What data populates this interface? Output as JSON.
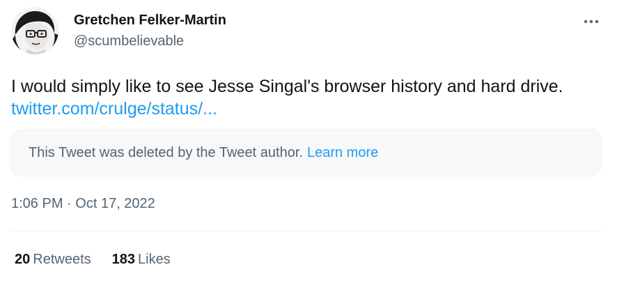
{
  "author": {
    "display_name": "Gretchen Felker-Martin",
    "handle": "@scumbelievable",
    "avatar_icon": "profile-portrait-drawing"
  },
  "tweet": {
    "text": "I would simply like to see Jesse Singal's browser history and hard drive.",
    "link_text": "twitter.com/crulge/status/..."
  },
  "quoted_tweet": {
    "message": "This Tweet was deleted by the Tweet author.",
    "learn_more_label": "Learn more"
  },
  "meta": {
    "time": "1:06 PM",
    "separator": "·",
    "date": "Oct 17, 2022"
  },
  "stats": {
    "retweets_count": "20",
    "retweets_label": "Retweets",
    "likes_count": "183",
    "likes_label": "Likes"
  },
  "icons": {
    "more": "more-horizontal-icon"
  },
  "colors": {
    "text_primary": "#0f1419",
    "text_secondary": "#536471",
    "link": "#1d9bf0",
    "quote_bg": "#f7f9f9",
    "divider": "#eff3f4"
  }
}
